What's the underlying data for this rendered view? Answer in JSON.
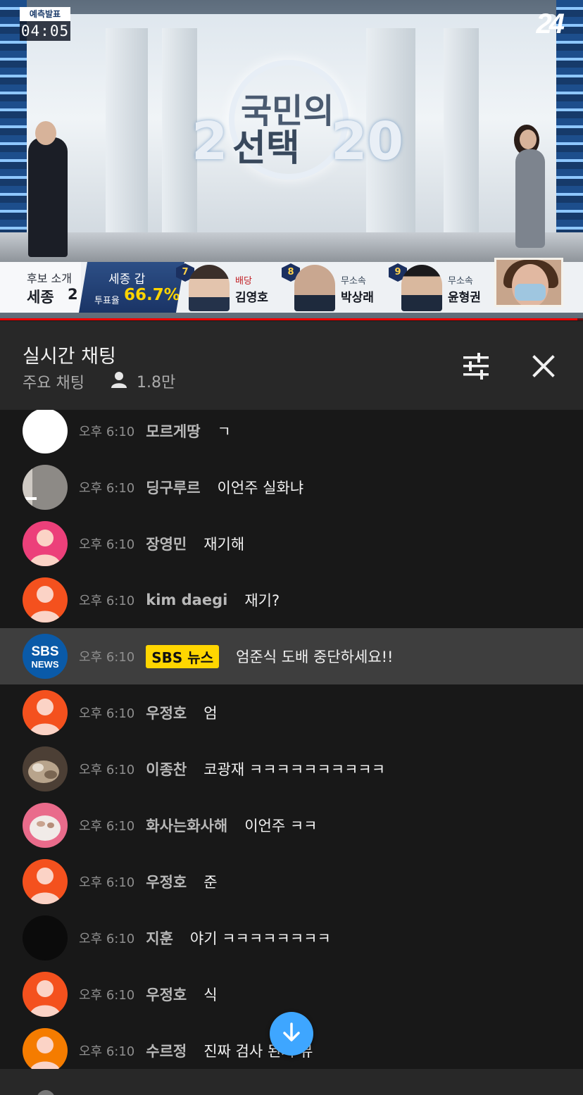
{
  "video": {
    "badge_label": "예측발표",
    "badge_time": "04:05",
    "channel_logo": "24",
    "show_logo_line1": "국민의",
    "show_logo_line2": "선택",
    "show_logo_year_left": "2",
    "show_logo_year_right": "20",
    "lower_third": {
      "intro_line1": "후보 소개",
      "intro_region": "세종",
      "intro_number": "2",
      "district": "세종 갑",
      "turnout_label": "투표율",
      "turnout_value": "66.7%",
      "candidates": [
        {
          "number": "7",
          "party": "배당",
          "name": "김영호"
        },
        {
          "number": "8",
          "party": "무소속",
          "name": "박상래"
        },
        {
          "number": "9",
          "party": "무소속",
          "name": "윤형권"
        }
      ]
    },
    "progress_fraction": 0.99,
    "progress_color": "#ee0000"
  },
  "chat_header": {
    "title": "실시간 채팅",
    "subtitle": "주요 채팅",
    "viewer_count": "1.8만",
    "icons": {
      "viewers": "person-icon",
      "filter": "tune-icon",
      "close": "close-icon"
    }
  },
  "messages": [
    {
      "time": "오후 6:10",
      "author": "모르게땅",
      "text": "ㄱ",
      "avatar": "white"
    },
    {
      "time": "오후 6:10",
      "author": "딩구루르",
      "text": "이언주 실화냐",
      "avatar": "photo-gray"
    },
    {
      "time": "오후 6:10",
      "author": "장영민",
      "text": "재기해",
      "avatar": "default-pink"
    },
    {
      "time": "오후 6:10",
      "author": "kim daegi",
      "text": "재기?",
      "avatar": "default-orange"
    },
    {
      "time": "오후 6:10",
      "author": "SBS 뉴스",
      "text": "엄준식 도배 중단하세요!!",
      "avatar": "sbs-news",
      "owner": true
    },
    {
      "time": "오후 6:10",
      "author": "우정호",
      "text": "엄",
      "avatar": "default-orange"
    },
    {
      "time": "오후 6:10",
      "author": "이종찬",
      "text": "코광재 ㅋㅋㅋㅋㅋㅋㅋㅋㅋㅋ",
      "avatar": "photo-cat"
    },
    {
      "time": "오후 6:10",
      "author": "화사는화사해",
      "text": "이언주 ㅋㅋ",
      "avatar": "photo-pink"
    },
    {
      "time": "오후 6:10",
      "author": "우정호",
      "text": "준",
      "avatar": "default-orange"
    },
    {
      "time": "오후 6:10",
      "author": "지훈",
      "text": "야기 ㅋㅋㅋㅋㅋㅋㅋㅋ",
      "avatar": "black"
    },
    {
      "time": "오후 6:10",
      "author": "우정호",
      "text": "식",
      "avatar": "default-orange"
    },
    {
      "time": "오후 6:10",
      "author": "수르정",
      "text": "진짜 검사 된거 뮤",
      "avatar": "default-orange2"
    }
  ],
  "sbs_avatar": {
    "line1": "SBS",
    "line2": "NEWS"
  },
  "colors": {
    "accent": "#3ea6ff",
    "owner_badge": "#ffd600",
    "default_orange": "#f4511e",
    "default_pink": "#ec407a",
    "sbs_blue": "#0a5aa8"
  },
  "scroll_button_icon": "arrow-down-icon"
}
